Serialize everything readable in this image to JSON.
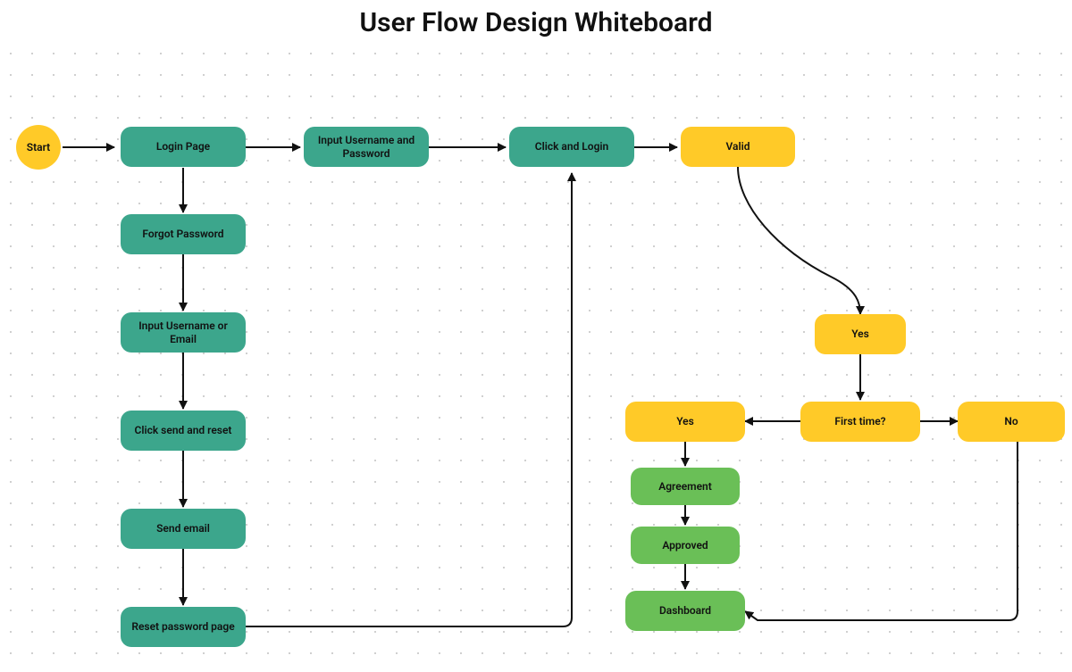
{
  "title": "User Flow Design Whiteboard",
  "colors": {
    "teal": "#3ca68c",
    "yellow": "#ffca28",
    "green": "#6abf57",
    "start": "#ffca28",
    "stroke": "#111111"
  },
  "nodes": {
    "start": {
      "label": "Start"
    },
    "login_page": {
      "label": "Login Page"
    },
    "input_user_pass": {
      "label": "Input Username and Password"
    },
    "click_login": {
      "label": "Click and Login"
    },
    "valid": {
      "label": "Valid"
    },
    "forgot_password": {
      "label": "Forgot Password"
    },
    "input_user_email": {
      "label": "Input Username or Email"
    },
    "click_send_reset": {
      "label": "Click send and reset"
    },
    "send_email": {
      "label": "Send email"
    },
    "reset_password_page": {
      "label": "Reset password page"
    },
    "yes_top": {
      "label": "Yes"
    },
    "first_time": {
      "label": "First time?"
    },
    "yes_left": {
      "label": "Yes"
    },
    "no_right": {
      "label": "No"
    },
    "agreement": {
      "label": "Agreement"
    },
    "approved": {
      "label": "Approved"
    },
    "dashboard": {
      "label": "Dashboard"
    }
  }
}
